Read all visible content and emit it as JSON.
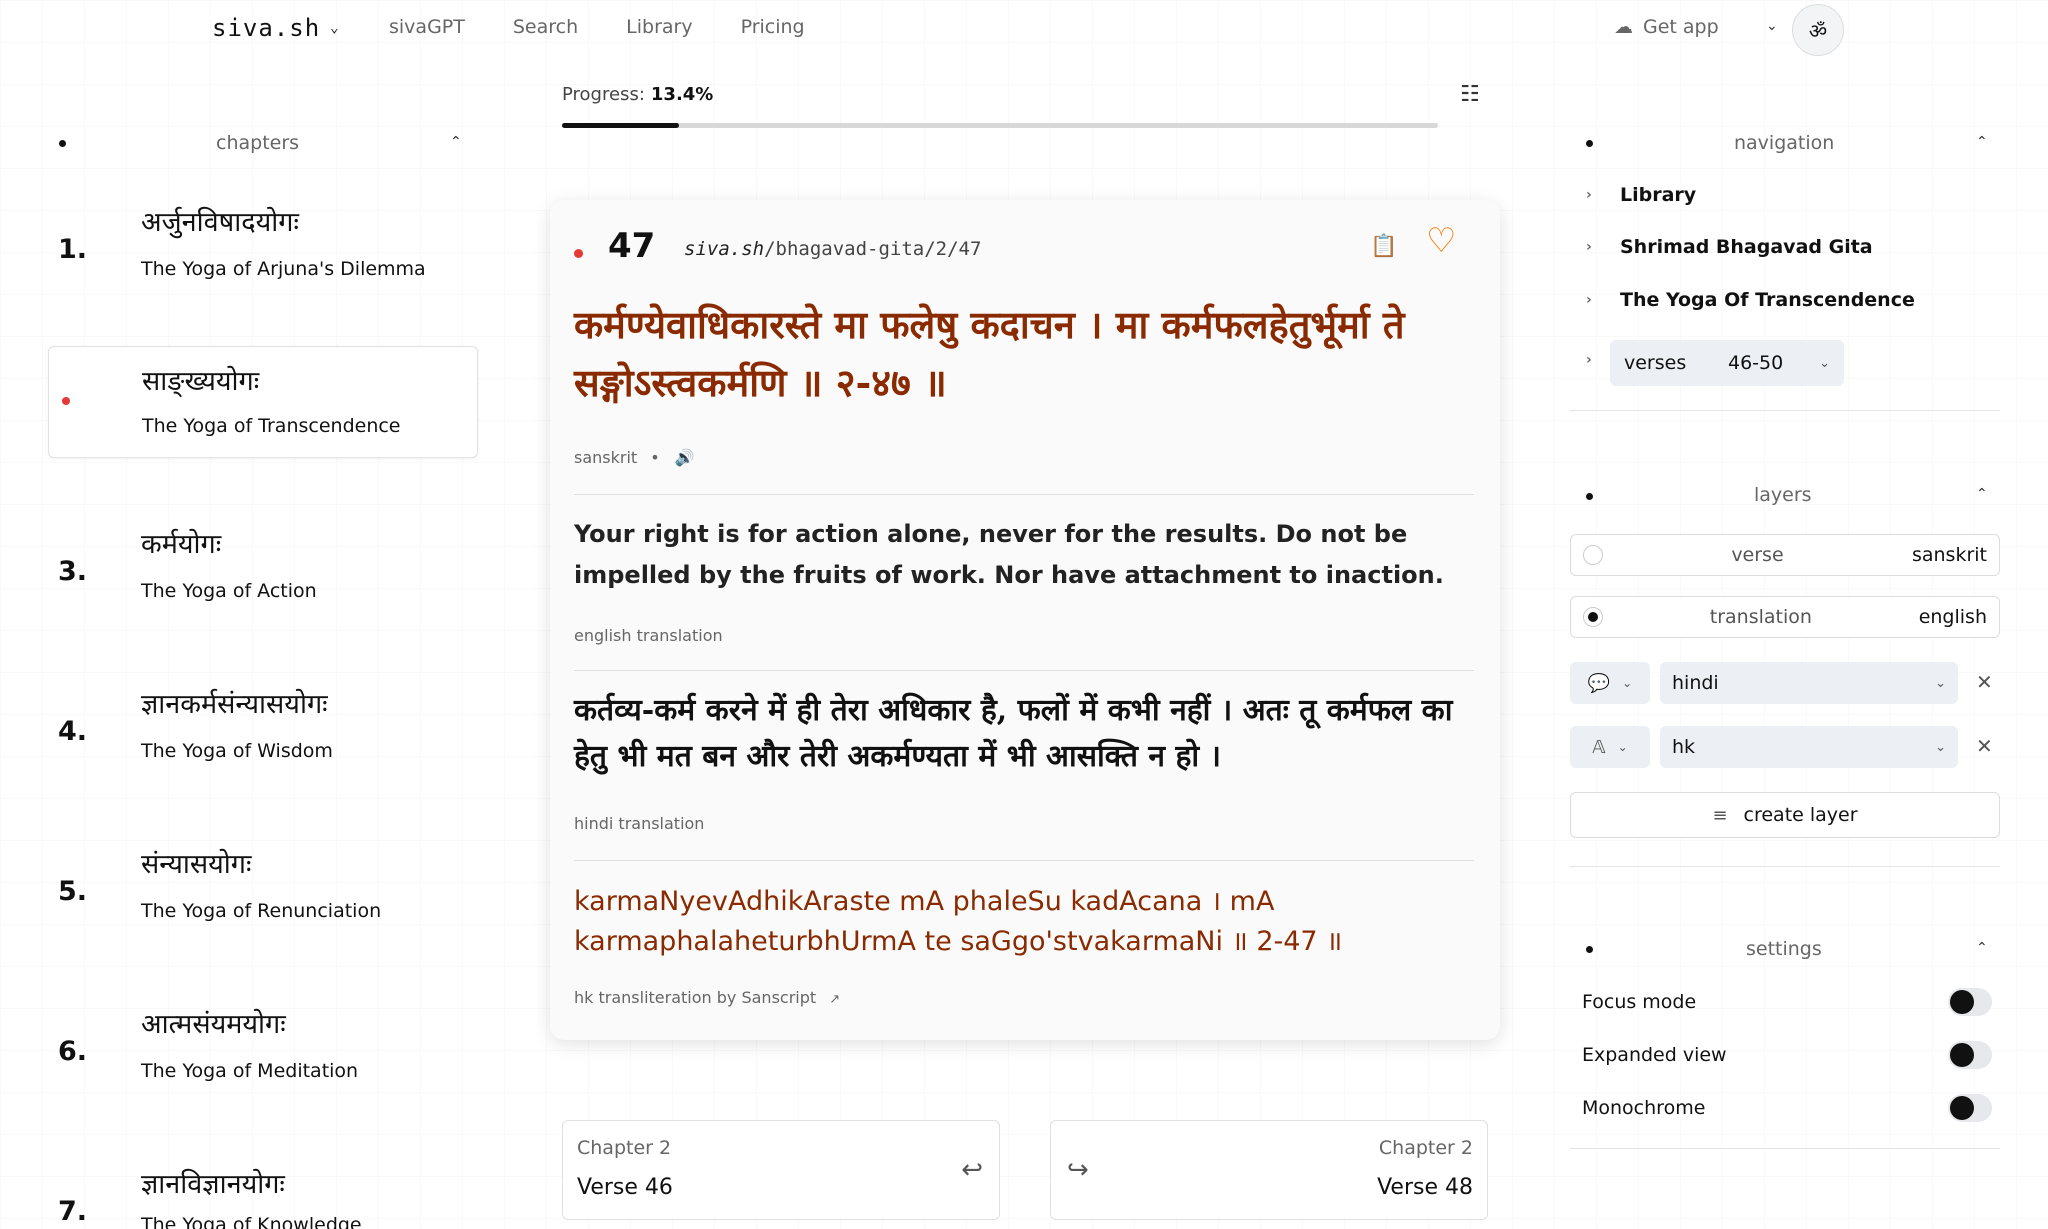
{
  "header": {
    "brand": "siva.sh",
    "nav": [
      "sivaGPT",
      "Search",
      "Library",
      "Pricing"
    ],
    "get_app": "Get app",
    "om": "ॐ"
  },
  "progress": {
    "label": "Progress:",
    "value": "13.4%",
    "fraction": 0.134
  },
  "chapters": {
    "title": "chapters",
    "items": [
      {
        "num": "1.",
        "dev": "अर्जुनविषादयोगः",
        "en": "The Yoga of Arjuna's Dilemma"
      },
      {
        "num": "",
        "dev": "साङ्ख्ययोगः",
        "en": "The Yoga of Transcendence"
      },
      {
        "num": "3.",
        "dev": "कर्मयोगः",
        "en": "The Yoga of Action"
      },
      {
        "num": "4.",
        "dev": "ज्ञानकर्मसंन्यासयोगः",
        "en": "The Yoga of Wisdom"
      },
      {
        "num": "5.",
        "dev": "संन्यासयोगः",
        "en": "The Yoga of Renunciation"
      },
      {
        "num": "6.",
        "dev": "आत्मसंयमयोगः",
        "en": "The Yoga of Meditation"
      },
      {
        "num": "7.",
        "dev": "ज्ञानविज्ञानयोगः",
        "en": "The Yoga of Knowledge"
      }
    ]
  },
  "verse": {
    "number": "47",
    "url_domain": "siva.sh",
    "url_path": "/bhagavad-gita/2/47",
    "sanskrit": "कर्मण्येवाधिकारस्ते मा फलेषु कदाचन । मा कर्मफलहेतुर्भूर्मा ते सङ्गोऽस्त्वकर्मणि ॥ २-४७ ॥",
    "sanskrit_label": "sanskrit",
    "english": "Your right is for action alone, never for the results. Do not be impelled by the fruits of work. Nor have attachment to inaction.",
    "english_label": "english translation",
    "hindi": "कर्तव्य-कर्म करने में ही तेरा अधिकार है, फलों में कभी नहीं । अतः तू कर्मफल का हेतु भी मत बन और तेरी अकर्मण्यता में भी आसक्ति न हो ।",
    "hindi_label": "hindi translation",
    "hk": "karmaNyevAdhikAraste mA phaleSu kadAcana । mA karmaphalaheturbhUrmA te saGgo'stvakarmaNi ॥ 2-47 ॥",
    "hk_label": "hk transliteration by Sanscript"
  },
  "pager": {
    "prev": {
      "chapter": "Chapter 2",
      "verse": "Verse 46"
    },
    "next": {
      "chapter": "Chapter 2",
      "verse": "Verse 48"
    }
  },
  "navigation": {
    "title": "navigation",
    "items": [
      "Library",
      "Shrimad Bhagavad Gita",
      "The Yoga Of Transcendence"
    ],
    "verses_label": "verses",
    "verses_value": "46-50"
  },
  "layers": {
    "title": "layers",
    "rows": [
      {
        "name": "verse",
        "value": "sanskrit"
      },
      {
        "name": "translation",
        "value": "english"
      }
    ],
    "extra1": "hindi",
    "extra2": "hk",
    "create": "create layer"
  },
  "settings": {
    "title": "settings",
    "items": [
      "Focus mode",
      "Expanded view",
      "Monochrome"
    ]
  }
}
